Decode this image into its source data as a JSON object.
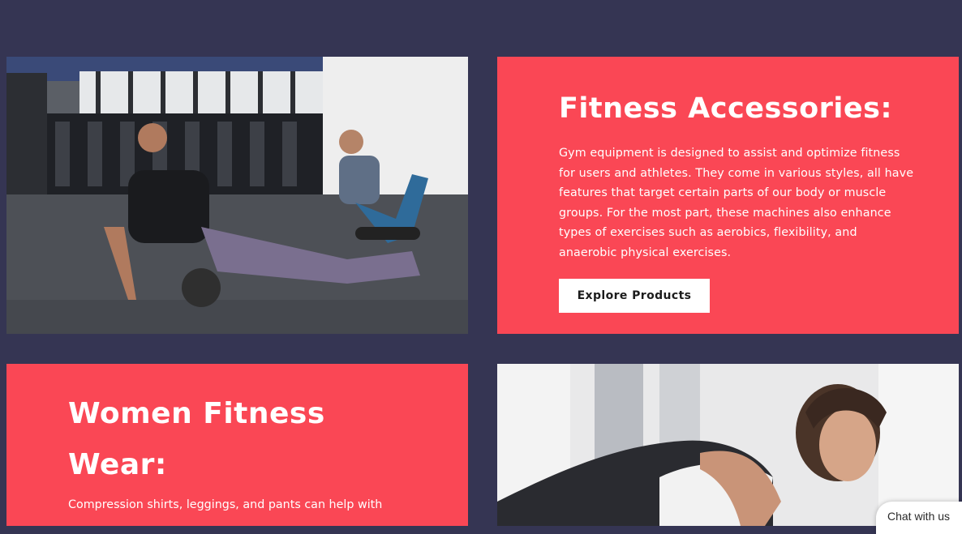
{
  "colors": {
    "background": "#353553",
    "accent": "#fa4755",
    "button_bg": "#ffffff",
    "text_light": "#ffffff"
  },
  "sections": [
    {
      "type": "photo",
      "alt": "fitness-class-foam-rolling-photo"
    },
    {
      "type": "promo",
      "title": "Fitness Accessories:",
      "body": "Gym equipment is designed to assist and optimize fitness for users and athletes. They come in various styles, all have features that target certain parts of our body or muscle groups. For the most part, these machines also enhance types of exercises such as aerobics, flexibility, and anaerobic physical exercises.",
      "button_label": "Explore Products"
    },
    {
      "type": "promo",
      "title": "Women Fitness Wear:",
      "body": "Compression shirts, leggings, and pants can help with"
    },
    {
      "type": "photo",
      "alt": "woman-stretching-photo"
    }
  ],
  "chat": {
    "label": "Chat with us"
  }
}
